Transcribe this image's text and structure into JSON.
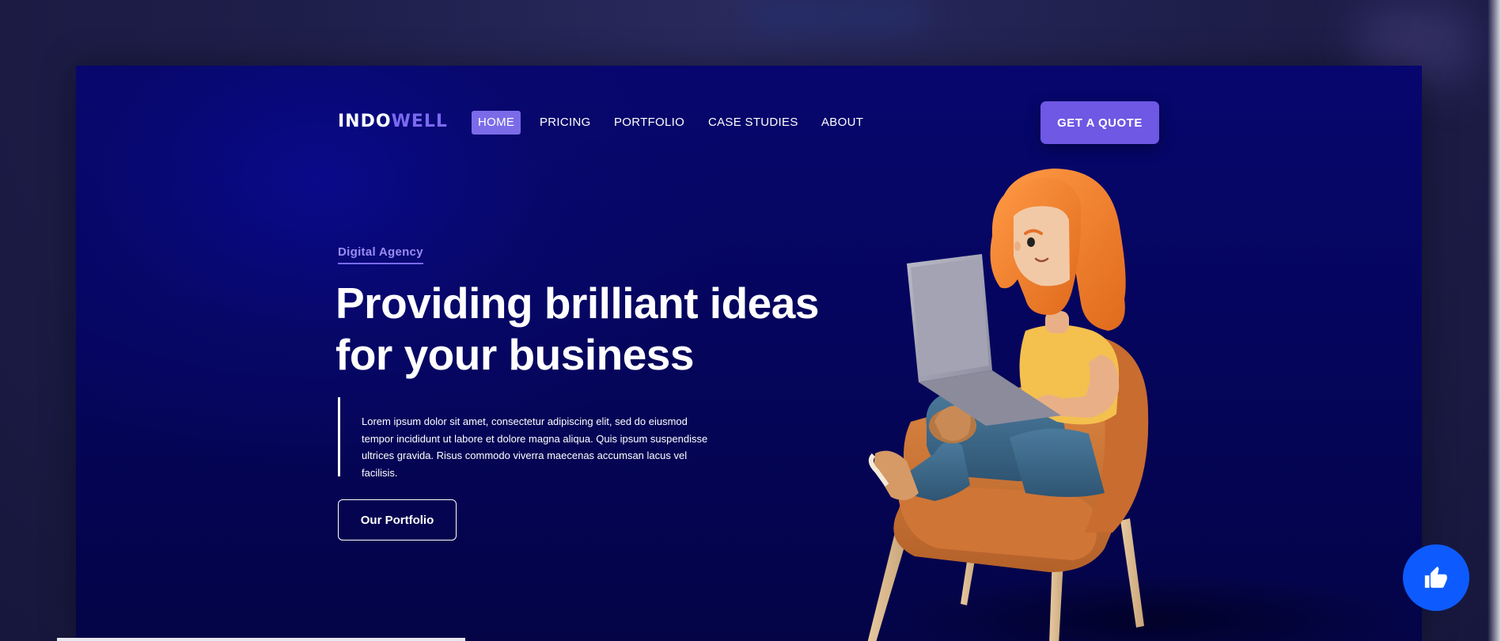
{
  "brand": {
    "logo_part1": "INDO",
    "logo_part2": "WELL"
  },
  "nav": {
    "items": [
      {
        "label": "HOME",
        "active": true
      },
      {
        "label": "PRICING",
        "active": false
      },
      {
        "label": "PORTFOLIO",
        "active": false
      },
      {
        "label": "CASE STUDIES",
        "active": false
      },
      {
        "label": "ABOUT",
        "active": false
      }
    ],
    "cta_label": "GET A QUOTE"
  },
  "hero": {
    "eyebrow": "Digital Agency",
    "headline_line1": "Providing brilliant ideas",
    "headline_line2": "for your business",
    "body": "Lorem ipsum dolor sit amet, consectetur adipiscing elit, sed do eiusmod tempor incididunt ut labore et dolore magna aliqua. Quis ipsum suspendisse ultrices gravida. Risus commodo viverra maecenas accumsan lacus vel facilisis.",
    "button_label": "Our Portfolio"
  },
  "floating": {
    "like_icon": "thumbs-up-icon"
  },
  "colors": {
    "accent": "#6e58e4",
    "hero_bg": "#05055a",
    "like_button": "#0d5bff",
    "hair": "#f07a2a",
    "shirt": "#f4c04e",
    "jeans": "#3d6a8c",
    "chair": "#d9823e"
  }
}
